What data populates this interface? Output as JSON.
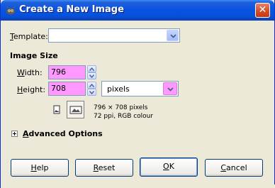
{
  "window": {
    "title": "Create a New Image",
    "close_glyph": "✕"
  },
  "template": {
    "label_mnemonic": "T",
    "label_rest": "emplate:",
    "value": ""
  },
  "image_size": {
    "heading": "Image Size",
    "width_mnemonic": "W",
    "width_label_rest": "idth:",
    "width_value": "796",
    "height_mnemonic": "H",
    "height_label_rest": "eight:",
    "height_value": "708",
    "unit": "pixels",
    "info_line1": "796 × 708 pixels",
    "info_line2": "72 ppi, RGB colour",
    "highlight_color": "#ff99ff"
  },
  "advanced": {
    "mnemonic": "A",
    "label_rest": "dvanced Options"
  },
  "buttons": {
    "help_mnemonic": "H",
    "help_rest": "elp",
    "reset_mnemonic": "R",
    "reset_rest": "eset",
    "ok_mnemonic": "O",
    "ok_rest": "K",
    "cancel_mnemonic": "C",
    "cancel_rest": "ancel"
  },
  "icons": {
    "title": "gimp-wilber-icon",
    "close": "close-icon",
    "portrait": "portrait-orientation-icon",
    "landscape": "landscape-orientation-icon",
    "expander": "plus-expander-icon"
  }
}
